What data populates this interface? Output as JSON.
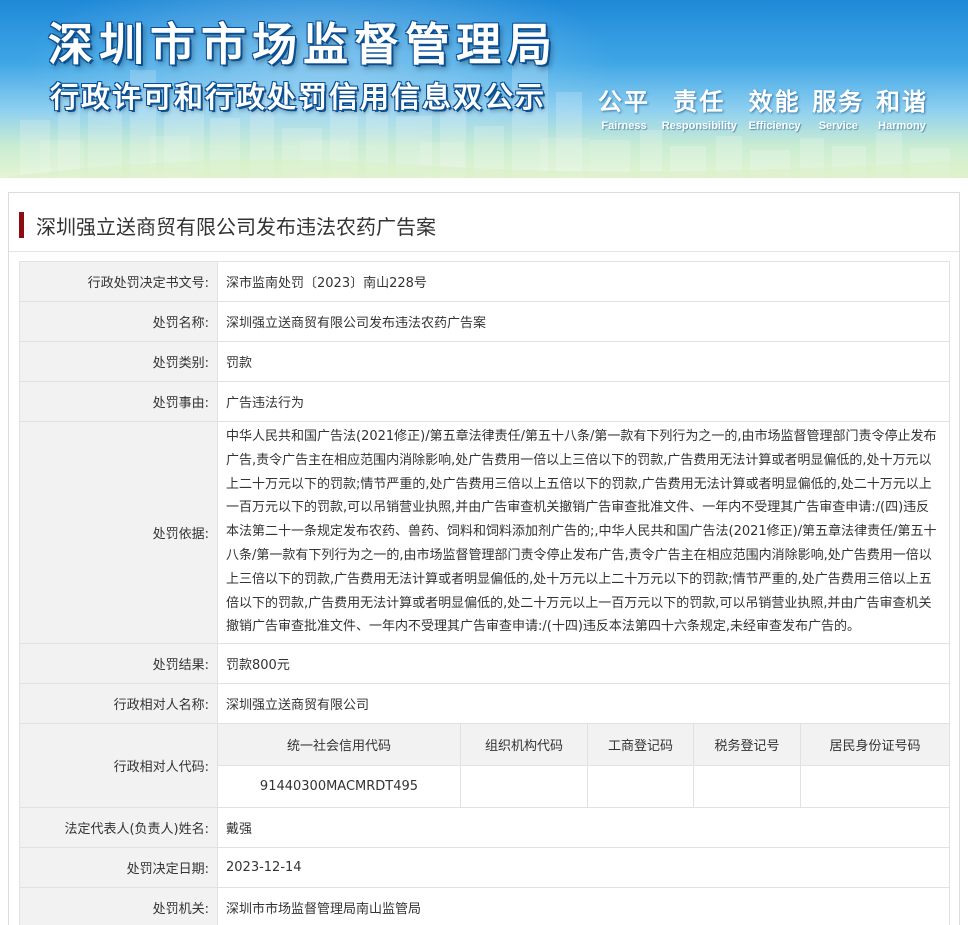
{
  "banner": {
    "title": "深圳市市场监督管理局",
    "subtitle": "行政许可和行政处罚信用信息双公示",
    "slogans": [
      {
        "cn": "公平",
        "en": "Fairness"
      },
      {
        "cn": "责任",
        "en": "Responsibility"
      },
      {
        "cn": "效能",
        "en": "Efficiency"
      },
      {
        "cn": "服务",
        "en": "Service"
      },
      {
        "cn": "和谐",
        "en": "Harmony"
      }
    ]
  },
  "page_title": "深圳强立送商贸有限公司发布违法农药广告案",
  "fields": {
    "decision_no": {
      "label": "行政处罚决定书文号:",
      "value": "深市监南处罚〔2023〕南山228号"
    },
    "penalty_name": {
      "label": "处罚名称:",
      "value": "深圳强立送商贸有限公司发布违法农药广告案"
    },
    "penalty_type": {
      "label": "处罚类别:",
      "value": "罚款"
    },
    "penalty_reason": {
      "label": "处罚事由:",
      "value": "广告违法行为"
    },
    "penalty_basis": {
      "label": "处罚依据:",
      "value": "中华人民共和国广告法(2021修正)/第五章法律责任/第五十八条/第一款有下列行为之一的,由市场监督管理部门责令停止发布广告,责令广告主在相应范围内消除影响,处广告费用一倍以上三倍以下的罚款,广告费用无法计算或者明显偏低的,处十万元以上二十万元以下的罚款;情节严重的,处广告费用三倍以上五倍以下的罚款,广告费用无法计算或者明显偏低的,处二十万元以上一百万元以下的罚款,可以吊销营业执照,并由广告审查机关撤销广告审查批准文件、一年内不受理其广告审查申请:/(四)违反本法第二十一条规定发布农药、兽药、饲料和饲料添加剂广告的;,中华人民共和国广告法(2021修正)/第五章法律责任/第五十八条/第一款有下列行为之一的,由市场监督管理部门责令停止发布广告,责令广告主在相应范围内消除影响,处广告费用一倍以上三倍以下的罚款,广告费用无法计算或者明显偏低的,处十万元以上二十万元以下的罚款;情节严重的,处广告费用三倍以上五倍以下的罚款,广告费用无法计算或者明显偏低的,处二十万元以上一百万元以下的罚款,可以吊销营业执照,并由广告审查机关撤销广告审查批准文件、一年内不受理其广告审查申请:/(十四)违反本法第四十六条规定,未经审查发布广告的。"
    },
    "penalty_result": {
      "label": "处罚结果:",
      "value": "罚款800元"
    },
    "counterparty_name": {
      "label": "行政相对人名称:",
      "value": "深圳强立送商贸有限公司"
    },
    "counterparty_code": {
      "label": "行政相对人代码:",
      "columns": [
        "统一社会信用代码",
        "组织机构代码",
        "工商登记码",
        "税务登记号",
        "居民身份证号码"
      ],
      "values": [
        "91440300MACMRDT495",
        "",
        "",
        "",
        ""
      ]
    },
    "legal_rep": {
      "label": "法定代表人(负责人)姓名:",
      "value": "戴强"
    },
    "decision_date": {
      "label": "处罚决定日期:",
      "value": "2023-12-14"
    },
    "authority": {
      "label": "处罚机关:",
      "value": "深圳市市场监督管理局南山监管局"
    }
  }
}
